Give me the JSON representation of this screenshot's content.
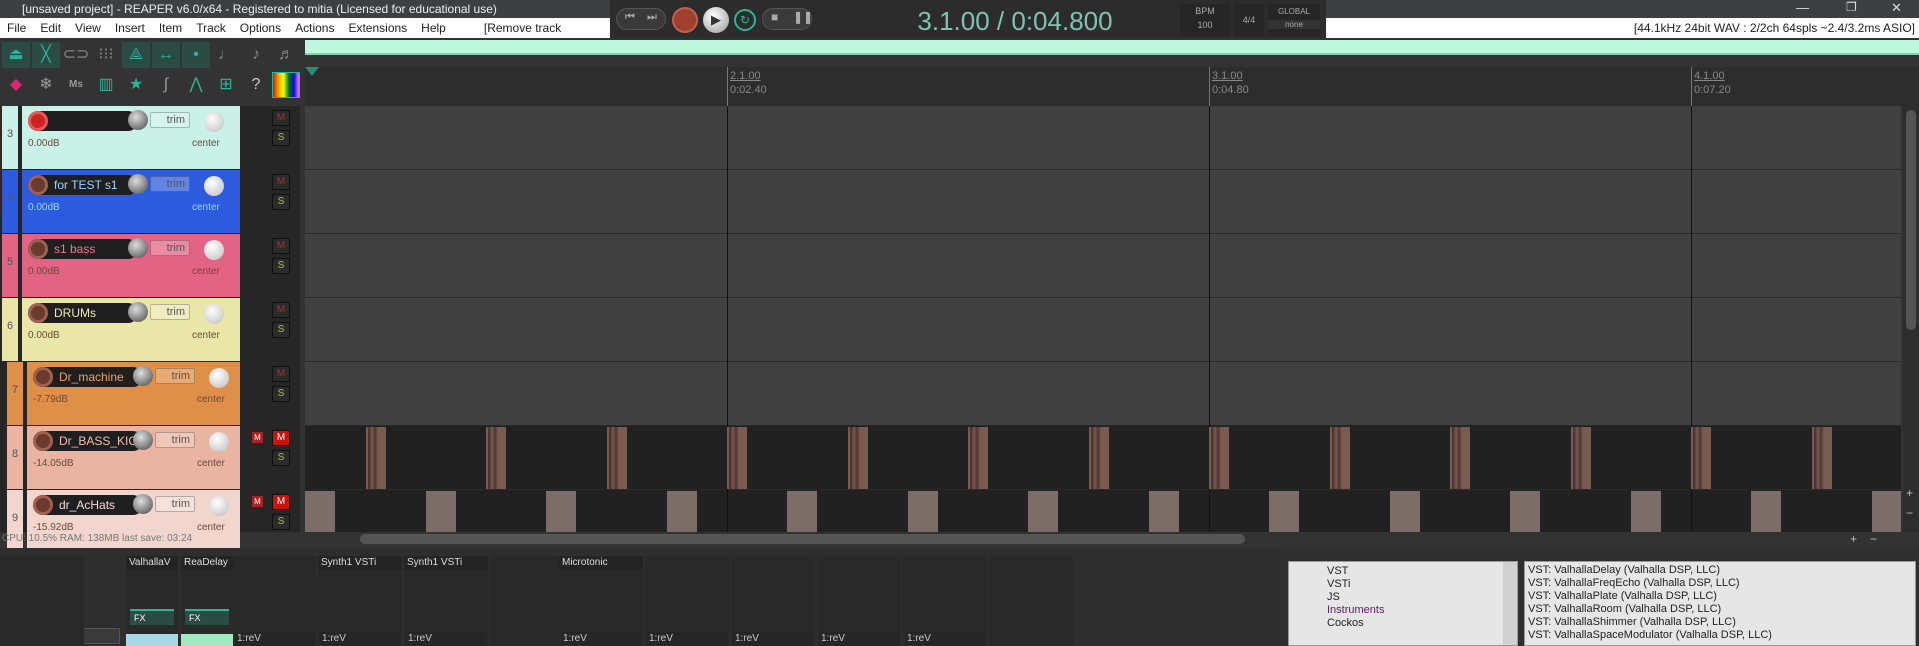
{
  "window": {
    "title": "[unsaved project] - REAPER v6.0/x64 - Registered to mitia (Licensed for educational use)"
  },
  "menu": [
    "File",
    "Edit",
    "View",
    "Insert",
    "Item",
    "Track",
    "Options",
    "Actions",
    "Extensions",
    "Help",
    "[Remove track selection]"
  ],
  "audio_info": "[44.1kHz 24bit WAV : 2/2ch 64spls ~2.4/3.2ms ASIO]",
  "transport": {
    "time": "3.1.00 / 0:04.800",
    "bpm_label": "BPM",
    "bpm": "100",
    "time_sig": "4/4",
    "global_label": "GLOBAL",
    "global_value": "none"
  },
  "toolbar_row2_text": "Ms",
  "ruler": [
    {
      "bar": 2,
      "label": "2.1.00",
      "time": "0:02.40"
    },
    {
      "bar": 3,
      "label": "3.1.00",
      "time": "0:04.80"
    },
    {
      "bar": 4,
      "label": "4.1.00",
      "time": "0:07.20"
    }
  ],
  "tracks": [
    {
      "num": "3",
      "name": "",
      "vol": "0.00dB",
      "pan": "center",
      "trim": "trim",
      "color": "#c9f1e8",
      "text": "#557",
      "armed": true,
      "mute": false,
      "indent": false
    },
    {
      "num": "4",
      "name": "for TEST s1",
      "vol": "0.00dB",
      "pan": "center",
      "trim": "trim",
      "color": "#2c5bdf",
      "text": "#9cd3ff",
      "armed": false,
      "mute": false,
      "indent": false
    },
    {
      "num": "5",
      "name": "s1 bass",
      "vol": "0.00dB",
      "pan": "center",
      "trim": "trim",
      "color": "#e36385",
      "text": "#ff7090",
      "armed": false,
      "mute": false,
      "indent": false
    },
    {
      "num": "6",
      "name": "DRUMs",
      "vol": "0.00dB",
      "pan": "center",
      "trim": "trim",
      "color": "#eae6a8",
      "text": "#eee8b0",
      "armed": false,
      "mute": false,
      "indent": false
    },
    {
      "num": "7",
      "name": "Dr_machine",
      "vol": "-7.79dB",
      "pan": "center",
      "trim": "trim",
      "color": "#e08f48",
      "text": "#f0a060",
      "armed": false,
      "mute": false,
      "indent": true
    },
    {
      "num": "8",
      "name": "Dr_BASS_KICK",
      "vol": "-14.05dB",
      "pan": "center",
      "trim": "trim",
      "color": "#e9b4a2",
      "text": "#f0c0b0",
      "armed": false,
      "mute": true,
      "indent": true
    },
    {
      "num": "9",
      "name": "dr_AcHats",
      "vol": "-15.92dB",
      "pan": "center",
      "trim": "trim",
      "color": "#f2d6ce",
      "text": "#f5dcd5",
      "armed": false,
      "mute": true,
      "indent": true
    }
  ],
  "items": {
    "kick_beats": [
      1,
      2,
      3,
      4,
      5,
      6,
      7,
      8,
      9,
      10,
      11,
      12,
      13
    ],
    "hat_beats": [
      0.5,
      1.5,
      2.5,
      3.5,
      4.5,
      5.5,
      6.5,
      7.5,
      8.5,
      9.5,
      10.5,
      11.5,
      12.5,
      13.5
    ],
    "kick_color": "#7b5a50",
    "hat_color": "#7d6d69"
  },
  "status": "CPU: 10.5% RAM: 138MB last save: 03:24",
  "mixer": {
    "master_fx": "FX",
    "fx_button": "FX",
    "columns": [
      {
        "fx": ""
      },
      {
        "fx": "ValhallaV"
      },
      {
        "fx": "ReaDelay"
      },
      {
        "fx": "",
        "send": "1:reV"
      },
      {
        "fx": "Synth1 VSTi",
        "send": "1:reV"
      },
      {
        "fx": "Synth1 VSTi",
        "send": "1:reV"
      },
      {
        "fx": ""
      },
      {
        "fx": "Microtonic",
        "send": "1:reV"
      },
      {
        "fx": "",
        "send": "1:reV"
      },
      {
        "fx": "",
        "send": "1:reV"
      },
      {
        "fx": "",
        "send": "1:reV"
      },
      {
        "fx": "",
        "send": "1:reV"
      },
      {
        "fx": ""
      }
    ]
  },
  "browser": {
    "tree": [
      "VST",
      "VSTi",
      "JS",
      "Instruments",
      "Cockos"
    ],
    "list": [
      "VST: ValhallaDelay (Valhalla DSP, LLC)",
      "VST: ValhallaFreqEcho (Valhalla DSP, LLC)",
      "VST: ValhallaPlate (Valhalla DSP, LLC)",
      "VST: ValhallaRoom (Valhalla DSP, LLC)",
      "VST: ValhallaShimmer (Valhalla DSP, LLC)",
      "VST: ValhallaSpaceModulator (Valhalla DSP, LLC)"
    ]
  }
}
